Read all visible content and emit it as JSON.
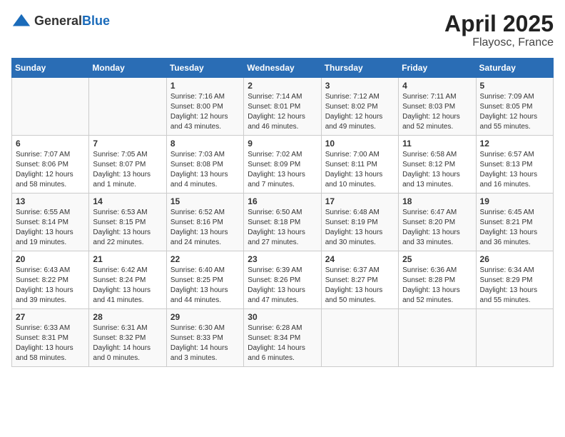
{
  "header": {
    "logo_general": "General",
    "logo_blue": "Blue",
    "month": "April 2025",
    "location": "Flayosc, France"
  },
  "weekdays": [
    "Sunday",
    "Monday",
    "Tuesday",
    "Wednesday",
    "Thursday",
    "Friday",
    "Saturday"
  ],
  "weeks": [
    [
      {
        "day": "",
        "info": ""
      },
      {
        "day": "",
        "info": ""
      },
      {
        "day": "1",
        "info": "Sunrise: 7:16 AM\nSunset: 8:00 PM\nDaylight: 12 hours\nand 43 minutes."
      },
      {
        "day": "2",
        "info": "Sunrise: 7:14 AM\nSunset: 8:01 PM\nDaylight: 12 hours\nand 46 minutes."
      },
      {
        "day": "3",
        "info": "Sunrise: 7:12 AM\nSunset: 8:02 PM\nDaylight: 12 hours\nand 49 minutes."
      },
      {
        "day": "4",
        "info": "Sunrise: 7:11 AM\nSunset: 8:03 PM\nDaylight: 12 hours\nand 52 minutes."
      },
      {
        "day": "5",
        "info": "Sunrise: 7:09 AM\nSunset: 8:05 PM\nDaylight: 12 hours\nand 55 minutes."
      }
    ],
    [
      {
        "day": "6",
        "info": "Sunrise: 7:07 AM\nSunset: 8:06 PM\nDaylight: 12 hours\nand 58 minutes."
      },
      {
        "day": "7",
        "info": "Sunrise: 7:05 AM\nSunset: 8:07 PM\nDaylight: 13 hours\nand 1 minute."
      },
      {
        "day": "8",
        "info": "Sunrise: 7:03 AM\nSunset: 8:08 PM\nDaylight: 13 hours\nand 4 minutes."
      },
      {
        "day": "9",
        "info": "Sunrise: 7:02 AM\nSunset: 8:09 PM\nDaylight: 13 hours\nand 7 minutes."
      },
      {
        "day": "10",
        "info": "Sunrise: 7:00 AM\nSunset: 8:11 PM\nDaylight: 13 hours\nand 10 minutes."
      },
      {
        "day": "11",
        "info": "Sunrise: 6:58 AM\nSunset: 8:12 PM\nDaylight: 13 hours\nand 13 minutes."
      },
      {
        "day": "12",
        "info": "Sunrise: 6:57 AM\nSunset: 8:13 PM\nDaylight: 13 hours\nand 16 minutes."
      }
    ],
    [
      {
        "day": "13",
        "info": "Sunrise: 6:55 AM\nSunset: 8:14 PM\nDaylight: 13 hours\nand 19 minutes."
      },
      {
        "day": "14",
        "info": "Sunrise: 6:53 AM\nSunset: 8:15 PM\nDaylight: 13 hours\nand 22 minutes."
      },
      {
        "day": "15",
        "info": "Sunrise: 6:52 AM\nSunset: 8:16 PM\nDaylight: 13 hours\nand 24 minutes."
      },
      {
        "day": "16",
        "info": "Sunrise: 6:50 AM\nSunset: 8:18 PM\nDaylight: 13 hours\nand 27 minutes."
      },
      {
        "day": "17",
        "info": "Sunrise: 6:48 AM\nSunset: 8:19 PM\nDaylight: 13 hours\nand 30 minutes."
      },
      {
        "day": "18",
        "info": "Sunrise: 6:47 AM\nSunset: 8:20 PM\nDaylight: 13 hours\nand 33 minutes."
      },
      {
        "day": "19",
        "info": "Sunrise: 6:45 AM\nSunset: 8:21 PM\nDaylight: 13 hours\nand 36 minutes."
      }
    ],
    [
      {
        "day": "20",
        "info": "Sunrise: 6:43 AM\nSunset: 8:22 PM\nDaylight: 13 hours\nand 39 minutes."
      },
      {
        "day": "21",
        "info": "Sunrise: 6:42 AM\nSunset: 8:24 PM\nDaylight: 13 hours\nand 41 minutes."
      },
      {
        "day": "22",
        "info": "Sunrise: 6:40 AM\nSunset: 8:25 PM\nDaylight: 13 hours\nand 44 minutes."
      },
      {
        "day": "23",
        "info": "Sunrise: 6:39 AM\nSunset: 8:26 PM\nDaylight: 13 hours\nand 47 minutes."
      },
      {
        "day": "24",
        "info": "Sunrise: 6:37 AM\nSunset: 8:27 PM\nDaylight: 13 hours\nand 50 minutes."
      },
      {
        "day": "25",
        "info": "Sunrise: 6:36 AM\nSunset: 8:28 PM\nDaylight: 13 hours\nand 52 minutes."
      },
      {
        "day": "26",
        "info": "Sunrise: 6:34 AM\nSunset: 8:29 PM\nDaylight: 13 hours\nand 55 minutes."
      }
    ],
    [
      {
        "day": "27",
        "info": "Sunrise: 6:33 AM\nSunset: 8:31 PM\nDaylight: 13 hours\nand 58 minutes."
      },
      {
        "day": "28",
        "info": "Sunrise: 6:31 AM\nSunset: 8:32 PM\nDaylight: 14 hours\nand 0 minutes."
      },
      {
        "day": "29",
        "info": "Sunrise: 6:30 AM\nSunset: 8:33 PM\nDaylight: 14 hours\nand 3 minutes."
      },
      {
        "day": "30",
        "info": "Sunrise: 6:28 AM\nSunset: 8:34 PM\nDaylight: 14 hours\nand 6 minutes."
      },
      {
        "day": "",
        "info": ""
      },
      {
        "day": "",
        "info": ""
      },
      {
        "day": "",
        "info": ""
      }
    ]
  ]
}
